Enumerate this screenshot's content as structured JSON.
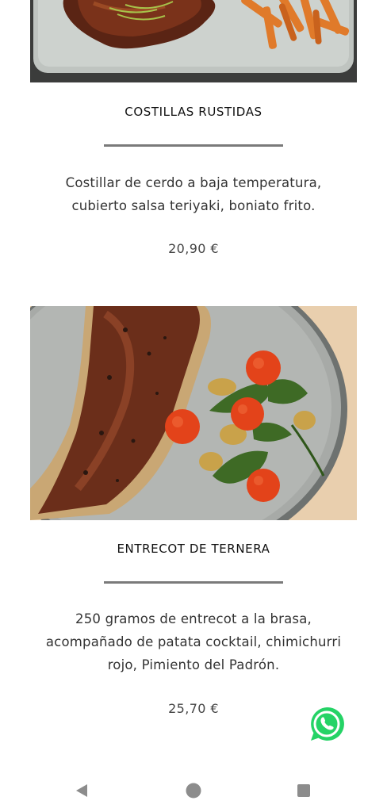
{
  "dishes": [
    {
      "image_icon": "ribs-photo",
      "title": "COSTILLAS RUSTIDAS",
      "description_lines": [
        "Costillar de cerdo a baja temperatura,",
        "cubierto salsa teriyaki, boniato frito."
      ],
      "price": "20,90 €"
    },
    {
      "image_icon": "steak-photo",
      "title": "ENTRECOT DE TERNERA",
      "description_lines": [
        "250 gramos de entrecot a la brasa,",
        "acompañado de patata cocktail, chimichurri",
        "rojo, Pimiento del Padrón."
      ],
      "price": "25,70 €"
    }
  ],
  "floating": {
    "icon": "whatsapp-icon",
    "color": "#25D366"
  },
  "navbar": {
    "back_icon": "back-triangle-icon",
    "home_icon": "home-circle-icon",
    "recents_icon": "recents-square-icon",
    "icon_color": "#8c8c8c"
  },
  "colors": {
    "divider": "#7a7a7a",
    "text": "#333333"
  }
}
